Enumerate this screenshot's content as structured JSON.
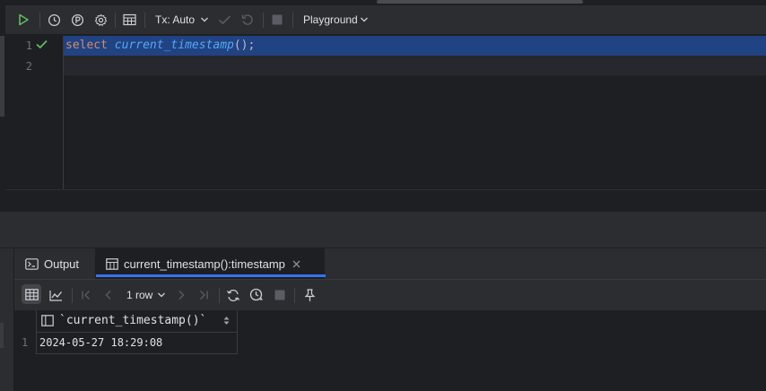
{
  "toolbar": {
    "tx_label": "Tx: Auto",
    "playground_label": "Playground"
  },
  "editor": {
    "lines": [
      {
        "number": "1",
        "keyword": "select",
        "function": "current_timestamp",
        "punct": "();"
      },
      {
        "number": "2"
      }
    ]
  },
  "results": {
    "tabs": [
      {
        "label": "Output"
      },
      {
        "label": "current_timestamp():timestamp"
      }
    ],
    "row_count": "1 row",
    "columns": [
      "`current_timestamp()`"
    ],
    "rows": [
      {
        "num": "1",
        "cells": [
          "2024-05-27 18:29:08"
        ]
      }
    ]
  },
  "colors": {
    "accent": "#3574f0",
    "run_green": "#5fb865",
    "selection": "#214283"
  }
}
